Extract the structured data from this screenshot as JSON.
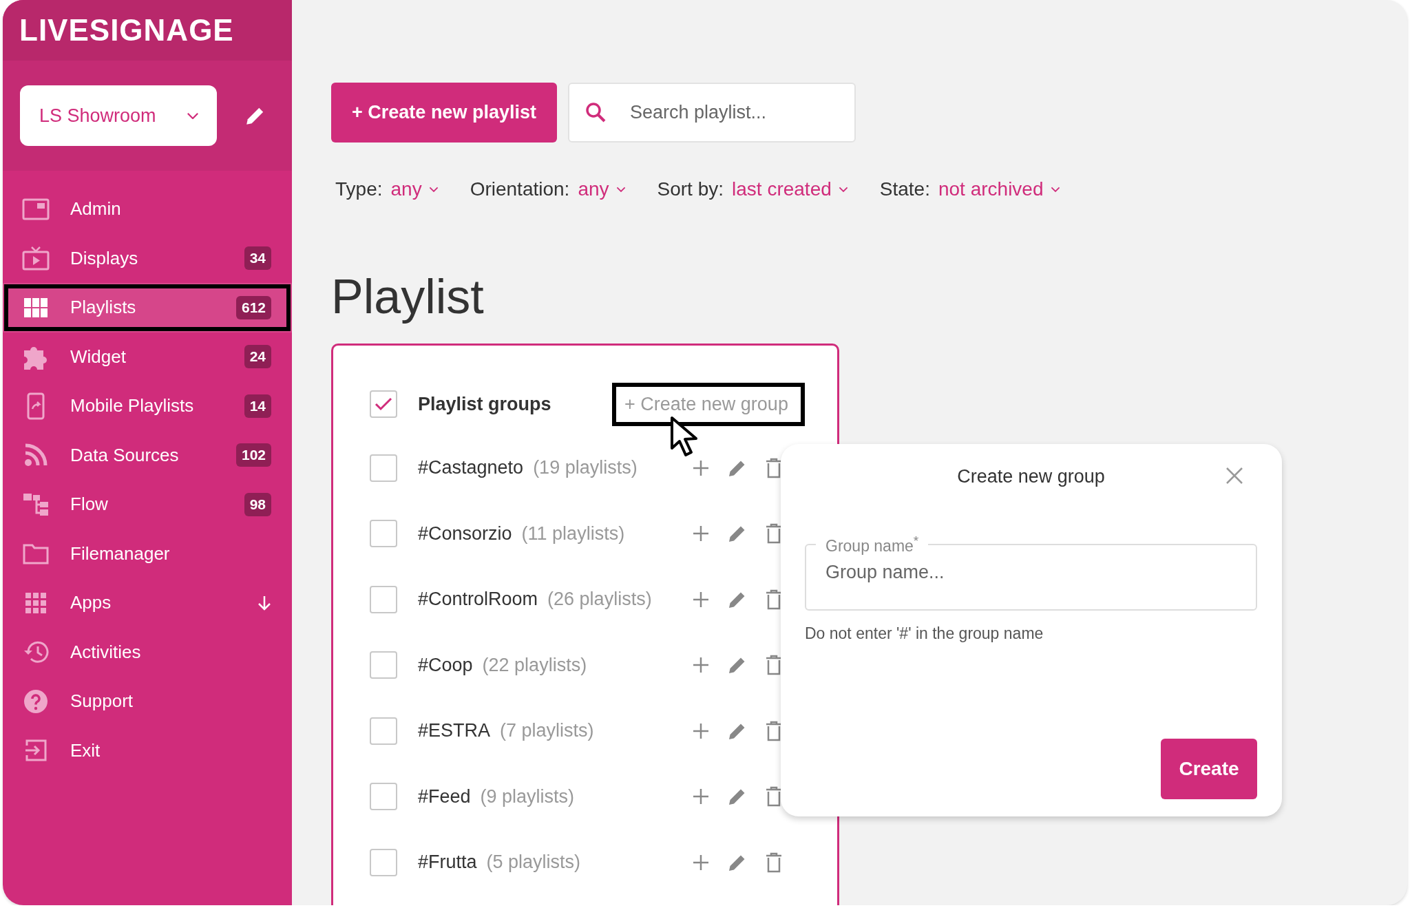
{
  "sidebar": {
    "logo": "LIVESIGNAGE",
    "workspace": "LS Showroom",
    "items": [
      {
        "label": "Admin",
        "selected": false,
        "annotated": false
      },
      {
        "label": "Displays",
        "badge": "34",
        "selected": false,
        "annotated": false
      },
      {
        "label": "Playlists",
        "badge": "612",
        "selected": true,
        "annotated": true
      },
      {
        "label": "Widget",
        "badge": "24",
        "selected": false,
        "annotated": false
      },
      {
        "label": "Mobile Playlists",
        "badge": "14",
        "selected": false,
        "annotated": false
      },
      {
        "label": "Data Sources",
        "badge": "102",
        "selected": false,
        "annotated": false
      },
      {
        "label": "Flow",
        "badge": "98",
        "selected": false,
        "annotated": false
      },
      {
        "label": "Filemanager",
        "selected": false,
        "annotated": false
      },
      {
        "label": "Apps",
        "selected": false,
        "annotated": false,
        "submenu": true
      },
      {
        "label": "Activities",
        "selected": false,
        "annotated": false
      },
      {
        "label": "Support",
        "selected": false,
        "annotated": false
      },
      {
        "label": "Exit",
        "selected": false,
        "annotated": false
      }
    ]
  },
  "toolbar": {
    "create_button": "+ Create new playlist",
    "search": {
      "placeholder": "Search playlist..."
    }
  },
  "filters": [
    {
      "label": "Type:",
      "value": "any"
    },
    {
      "label": "Orientation:",
      "value": "any"
    },
    {
      "label": "Sort by:",
      "value": "last created"
    },
    {
      "label": "State:",
      "value": "not archived"
    }
  ],
  "page_title": "Playlist",
  "groups": {
    "header": {
      "label": "Playlist groups",
      "checked": true
    },
    "create_link": {
      "label": "+ Create new group",
      "annotated": true
    },
    "rows": [
      {
        "name": "#Castagneto",
        "count": "(19 playlists)",
        "checked": false
      },
      {
        "name": "#Consorzio",
        "count": "(11 playlists)",
        "checked": false
      },
      {
        "name": "#ControlRoom",
        "count": "(26 playlists)",
        "checked": false
      },
      {
        "name": "#Coop",
        "count": "(22 playlists)",
        "checked": false
      },
      {
        "name": "#ESTRA",
        "count": "(7 playlists)",
        "checked": false
      },
      {
        "name": "#Feed",
        "count": "(9 playlists)",
        "checked": false
      },
      {
        "name": "#Frutta",
        "count": "(5 playlists)",
        "checked": false
      }
    ]
  },
  "dialog": {
    "title": "Create new group",
    "field": {
      "label": "Group name",
      "required_mark": "*",
      "placeholder": "Group name..."
    },
    "hint": "Do not enter '#' in the group name",
    "create_button": "Create"
  }
}
